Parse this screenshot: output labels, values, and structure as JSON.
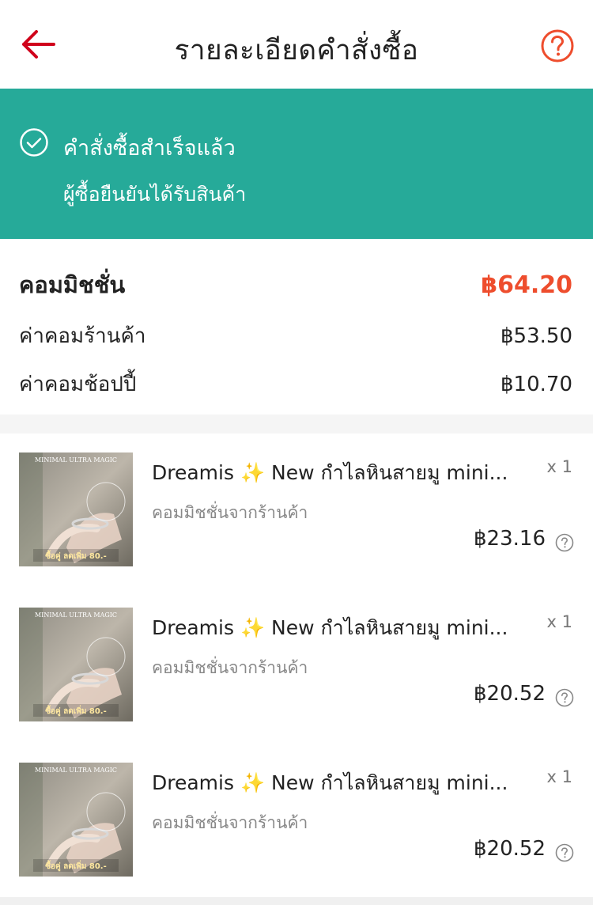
{
  "header": {
    "title": "รายละเอียดคำสั่งซื้อ",
    "back_icon": "arrow-left-icon",
    "help_icon": "question-circle-icon"
  },
  "status": {
    "icon": "check-circle-icon",
    "title": "คำสั่งซื้อสำเร็จแล้ว",
    "subtitle": "ผู้ซื้อยืนยันได้รับสินค้า",
    "background": "#26aa99"
  },
  "commission": {
    "total_label": "คอมมิชชั่น",
    "total_value": "฿64.20",
    "total_color": "#ee4d2d",
    "rows": [
      {
        "label": "ค่าคอมร้านค้า",
        "value": "฿53.50"
      },
      {
        "label": "ค่าคอมช้อปปี้",
        "value": "฿10.70"
      }
    ]
  },
  "items": [
    {
      "title_prefix": "Dreamis ",
      "sparkle": "✨",
      "title_suffix": " New กำไลหินสายมู mini...",
      "qty": "x 1",
      "subtitle": "คอมมิชชั่นจากร้านค้า",
      "price": "฿23.16",
      "thumb_top": "MINIMAL ULTRA MAGIC",
      "thumb_bottom": "ซื้อคู่ ลดเพิ่ม 80.-"
    },
    {
      "title_prefix": "Dreamis ",
      "sparkle": "✨",
      "title_suffix": " New กำไลหินสายมู mini...",
      "qty": "x 1",
      "subtitle": "คอมมิชชั่นจากร้านค้า",
      "price": "฿20.52",
      "thumb_top": "MINIMAL ULTRA MAGIC",
      "thumb_bottom": "ซื้อคู่ ลดเพิ่ม 80.-"
    },
    {
      "title_prefix": "Dreamis ",
      "sparkle": "✨",
      "title_suffix": " New กำไลหินสายมู mini...",
      "qty": "x 1",
      "subtitle": "คอมมิชชั่นจากร้านค้า",
      "price": "฿20.52",
      "thumb_top": "MINIMAL ULTRA MAGIC",
      "thumb_bottom": "ซื้อคู่ ลดเพิ่ม 80.-"
    }
  ]
}
